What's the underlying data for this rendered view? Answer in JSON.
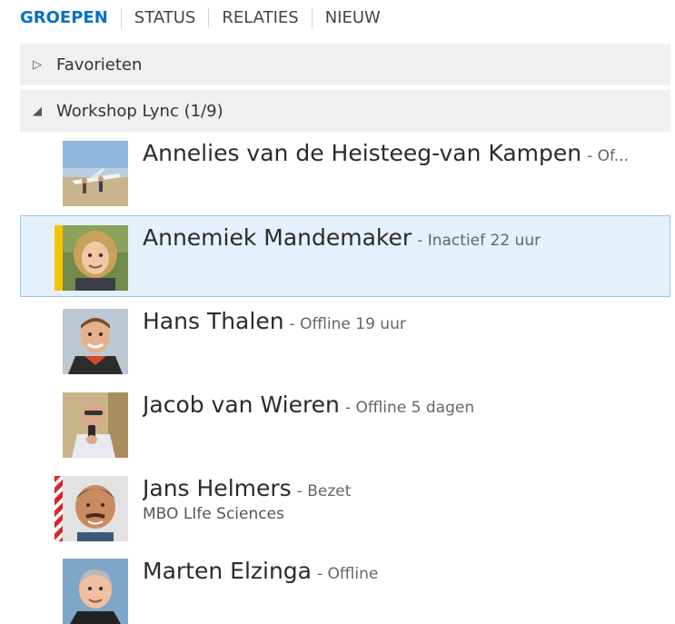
{
  "tabs": [
    {
      "label": "GROEPEN",
      "active": true
    },
    {
      "label": "STATUS",
      "active": false
    },
    {
      "label": "RELATIES",
      "active": false
    },
    {
      "label": "NIEUW",
      "active": false
    }
  ],
  "groups": {
    "favorites": {
      "arrow": "▷",
      "label": "Favorieten",
      "expanded": false
    },
    "workshop": {
      "arrow": "◢",
      "label": "Workshop Lync (1/9)",
      "expanded": true
    }
  },
  "contacts": [
    {
      "name": "Annelies van de Heisteeg-van Kampen",
      "status": "- Of...",
      "subtitle": "",
      "presence": "offline",
      "avatar_icon": "glider-photo-avatar"
    },
    {
      "name": "Annemiek Mandemaker",
      "status": "- Inactief 22 uur",
      "subtitle": "",
      "presence": "away",
      "avatar_icon": "woman-photo-avatar"
    },
    {
      "name": "Hans Thalen",
      "status": "- Offline 19 uur",
      "subtitle": "",
      "presence": "offline",
      "avatar_icon": "man-photo-avatar"
    },
    {
      "name": "Jacob van Wieren",
      "status": "- Offline 5 dagen",
      "subtitle": "",
      "presence": "offline",
      "avatar_icon": "man-photo-avatar"
    },
    {
      "name": "Jans Helmers",
      "status": "- Bezet",
      "subtitle": "MBO LIfe Sciences",
      "presence": "busy",
      "avatar_icon": "man-photo-avatar"
    },
    {
      "name": "Marten Elzinga",
      "status": "- Offline",
      "subtitle": "",
      "presence": "offline",
      "avatar_icon": "man-photo-avatar"
    }
  ],
  "colors": {
    "accent": "#0072c6",
    "away": "#f6c400",
    "busy": "#d9262a",
    "selected_bg": "#e4f0fb",
    "selected_border": "#99c6ea",
    "group_bg": "#f0f0f0"
  }
}
